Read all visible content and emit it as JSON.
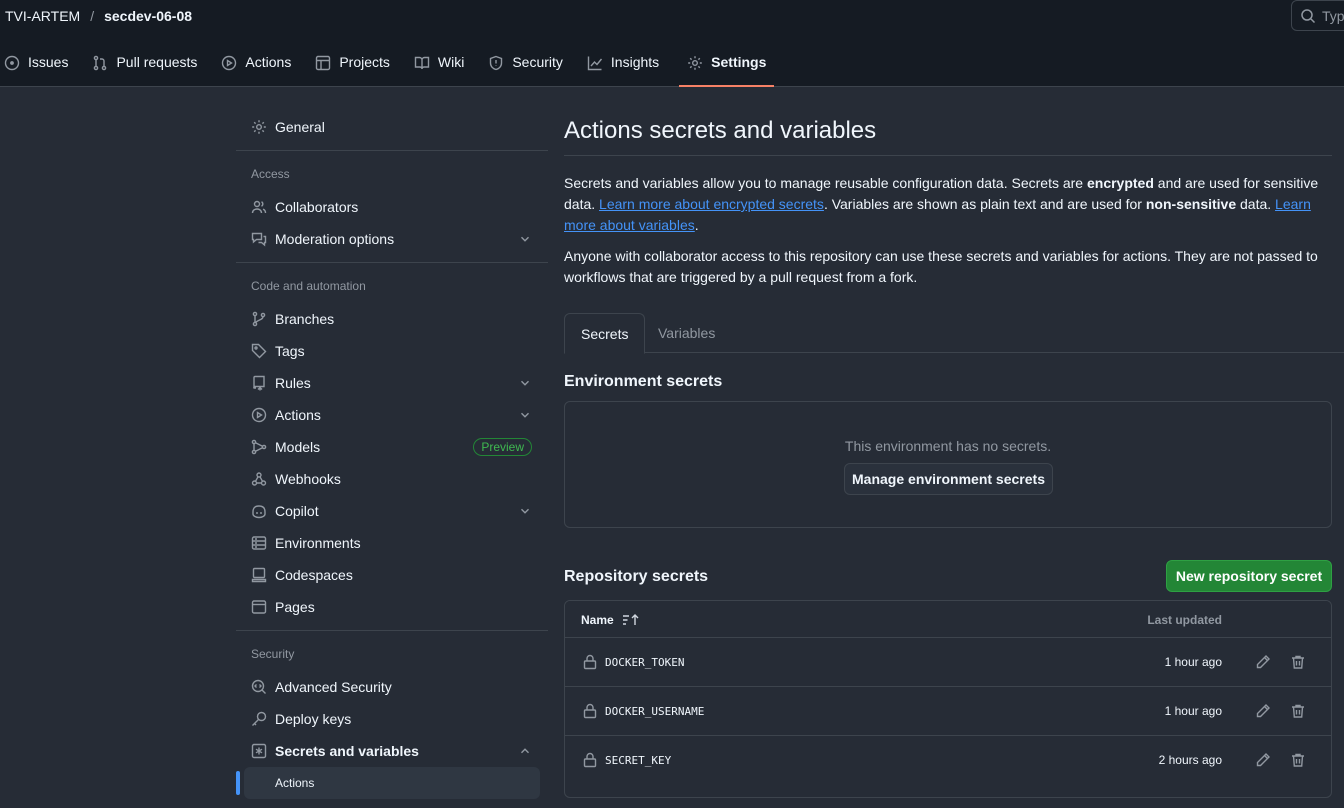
{
  "repo": {
    "owner": "TVI-ARTEM",
    "separator": "/",
    "name": "secdev-06-08"
  },
  "search": {
    "placeholder": "Typ"
  },
  "nav": {
    "tabs": [
      {
        "label": "Issues",
        "icon": "issue-icon"
      },
      {
        "label": "Pull requests",
        "icon": "pull-request-icon"
      },
      {
        "label": "Actions",
        "icon": "play-icon"
      },
      {
        "label": "Projects",
        "icon": "table-icon"
      },
      {
        "label": "Wiki",
        "icon": "book-icon"
      },
      {
        "label": "Security",
        "icon": "shield-icon"
      },
      {
        "label": "Insights",
        "icon": "graph-icon"
      },
      {
        "label": "Settings",
        "icon": "gear-icon",
        "active": true
      }
    ]
  },
  "sidebar": {
    "general": "General",
    "groups": {
      "access": "Access",
      "code_automation": "Code and automation",
      "security": "Security"
    },
    "items": {
      "collaborators": "Collaborators",
      "moderation": "Moderation options",
      "branches": "Branches",
      "tags": "Tags",
      "rules": "Rules",
      "actions": "Actions",
      "models": "Models",
      "models_badge": "Preview",
      "webhooks": "Webhooks",
      "copilot": "Copilot",
      "environments": "Environments",
      "codespaces": "Codespaces",
      "pages": "Pages",
      "advanced_security": "Advanced Security",
      "deploy_keys": "Deploy keys",
      "secrets_variables": "Secrets and variables",
      "sub_actions": "Actions"
    }
  },
  "main": {
    "title": "Actions secrets and variables",
    "intro": {
      "p1_a": "Secrets and variables allow you to manage reusable configuration data. Secrets are ",
      "p1_b": "encrypted",
      "p1_c": " and are used for sensitive data. ",
      "p1_link1": "Learn more about encrypted secrets",
      "p1_d": ". Variables are shown as plain text and are used for ",
      "p1_e": "non-sensitive",
      "p1_f": " data. ",
      "p1_link2": "Learn more about variables",
      "p1_g": ".",
      "p2": "Anyone with collaborator access to this repository can use these secrets and variables for actions. They are not passed to workflows that are triggered by a pull request from a fork."
    },
    "tabs": {
      "secrets": "Secrets",
      "variables": "Variables"
    },
    "env": {
      "title": "Environment secrets",
      "empty": "This environment has no secrets.",
      "manage_button": "Manage environment secrets"
    },
    "repo_secrets": {
      "title": "Repository secrets",
      "new_button": "New repository secret",
      "col_name": "Name",
      "col_updated": "Last updated",
      "rows": [
        {
          "name": "DOCKER_TOKEN",
          "updated": "1 hour ago"
        },
        {
          "name": "DOCKER_USERNAME",
          "updated": "1 hour ago"
        },
        {
          "name": "SECRET_KEY",
          "updated": "2 hours ago"
        }
      ]
    }
  },
  "colors": {
    "accent": "#4493f8",
    "active_tab": "#f78166",
    "primary": "#238636"
  }
}
